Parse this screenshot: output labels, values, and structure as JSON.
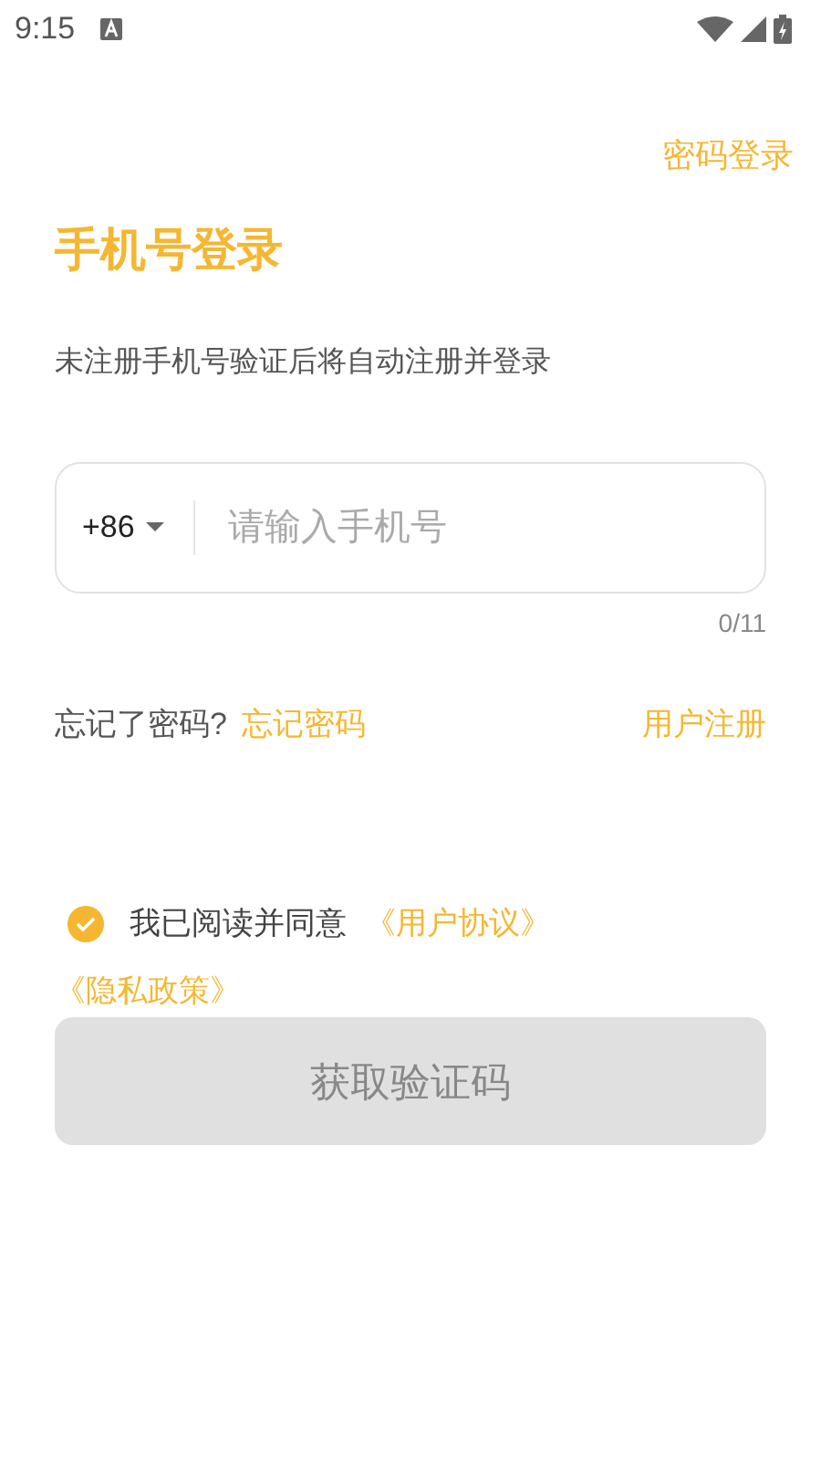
{
  "status_bar": {
    "time": "9:15"
  },
  "top_link": "密码登录",
  "title": "手机号登录",
  "subtitle": "未注册手机号验证后将自动注册并登录",
  "phone_field": {
    "country_code": "+86",
    "placeholder": "请输入手机号",
    "counter": "0/11"
  },
  "links_row": {
    "prompt": "忘记了密码?",
    "forgot_link": "忘记密码",
    "register_link": "用户注册"
  },
  "agreement": {
    "checked": true,
    "text": "我已阅读并同意",
    "links": [
      "《用户协议》",
      "《隐私政策》"
    ]
  },
  "submit_button": {
    "label": "获取验证码",
    "disabled": true
  }
}
